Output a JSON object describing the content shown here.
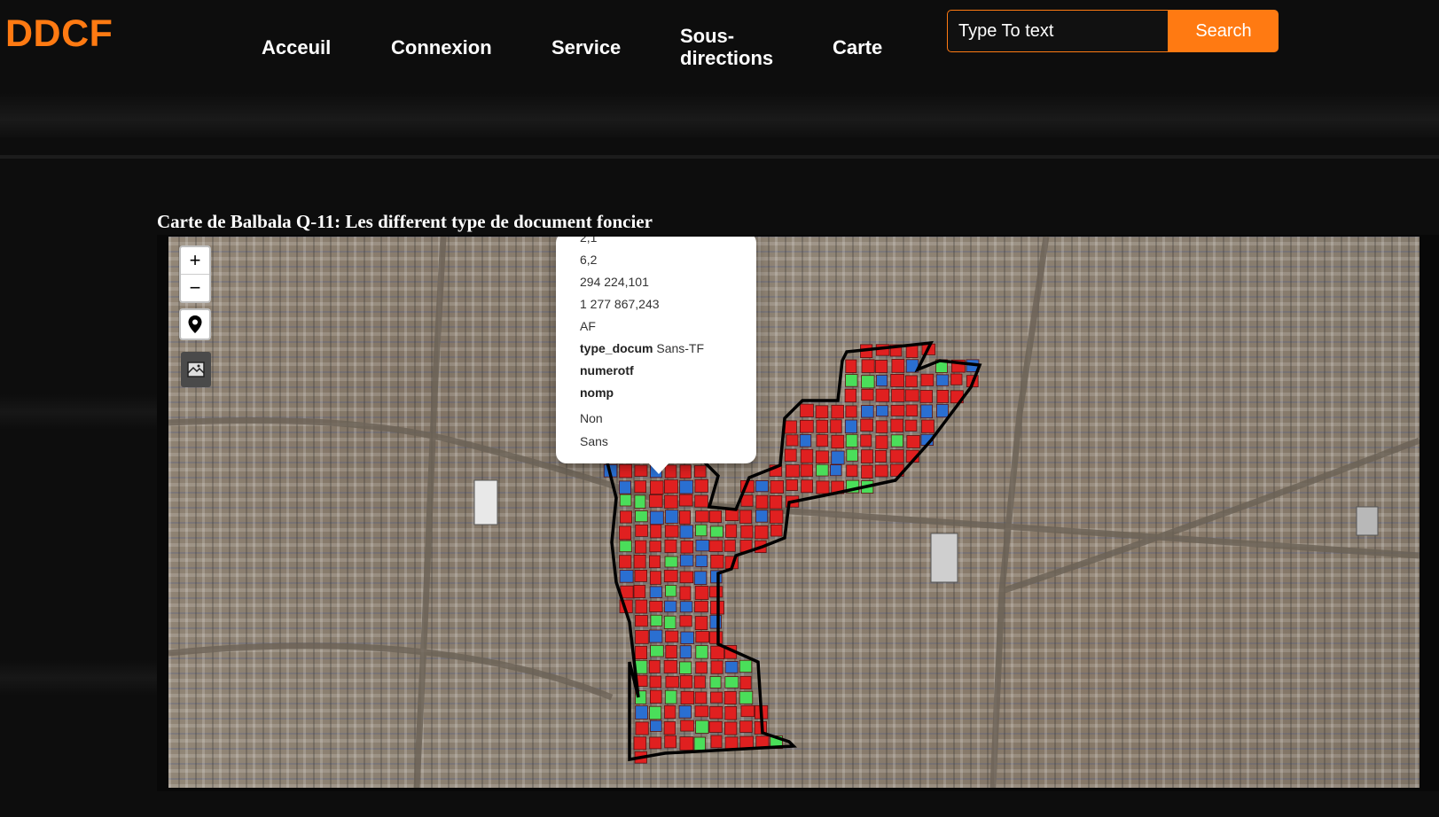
{
  "brand": {
    "logo": "DDCF"
  },
  "nav": {
    "home": "Acceuil",
    "login": "Connexion",
    "service": "Service",
    "subdirections_line1": "Sous-",
    "subdirections_line2": "directions",
    "map": "Carte"
  },
  "search": {
    "placeholder": "Type To text",
    "button": "Search"
  },
  "map": {
    "title": "Carte de Balbala Q-11: Les different type de document foncier",
    "zoom_in": "+",
    "zoom_out": "−"
  },
  "popup": {
    "rows": [
      "2,1",
      "6,2",
      "294 224,101",
      "1 277 867,243",
      "AF"
    ],
    "type_docum_key": "type_docum",
    "type_docum_value": "Sans-TF",
    "numerotf_key": "numerotf",
    "nomp_key": "nomp",
    "extra": [
      "Non",
      "Sans"
    ]
  },
  "colors": {
    "accent": "#ff7a12",
    "parcel_sans_tf": "#e02020",
    "parcel_af": "#2a6fd1",
    "parcel_tf": "#4ade5a",
    "boundary": "#000000"
  },
  "icons": {
    "locate": "map-pin-icon",
    "layers": "layers-icon"
  }
}
